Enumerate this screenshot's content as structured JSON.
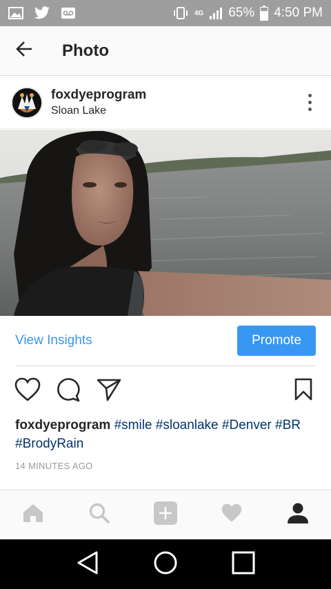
{
  "status_bar": {
    "left_icons": [
      "image-icon",
      "twitter-icon",
      "voicemail-icon"
    ],
    "network": "4G",
    "battery": "65%",
    "time": "4:50 PM"
  },
  "app_bar": {
    "title": "Photo",
    "back_icon": "arrow-left-icon"
  },
  "post": {
    "username": "foxdyeprogram",
    "location": "Sloan Lake",
    "more_icon": "more-vertical-icon",
    "photo_icon": "photo-selfie-lake"
  },
  "insights": {
    "view_insights_label": "View Insights",
    "promote_label": "Promote"
  },
  "actions": [
    "heart-icon",
    "comment-icon",
    "share-icon",
    "bookmark-icon"
  ],
  "caption": {
    "username": "foxdyeprogram",
    "hashtags": [
      "#smile",
      "#sloanlake",
      "#Denver",
      "#BR",
      "#BrodyRain"
    ],
    "timestamp": "14 MINUTES AGO"
  },
  "tab_bar": [
    "home-icon",
    "search-icon",
    "add-icon",
    "activity-heart-icon",
    "profile-icon"
  ],
  "nav_bar": [
    "back-triangle-icon",
    "home-circle-icon",
    "recents-square-icon"
  ],
  "colors": {
    "accent": "#3897f0",
    "hashtag": "#003569",
    "status_bar": "#9e9e9e"
  }
}
